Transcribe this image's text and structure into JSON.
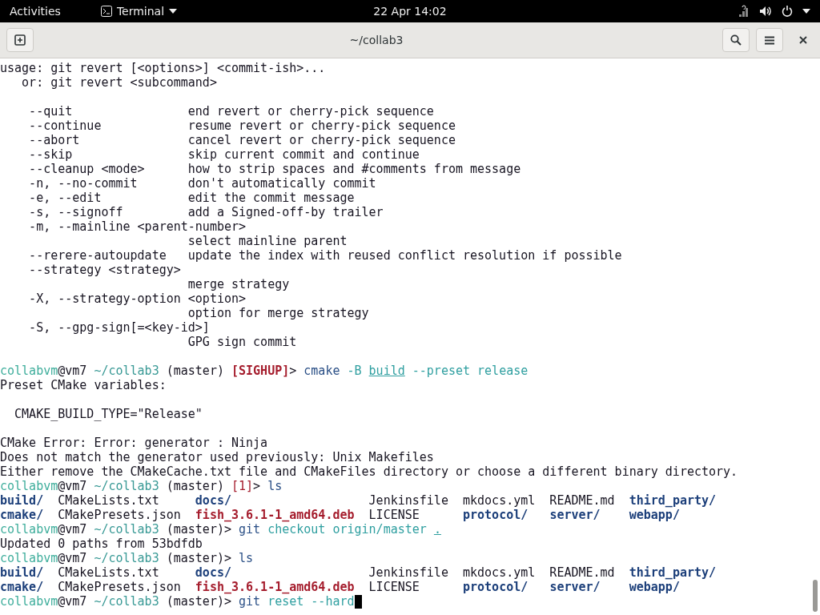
{
  "top_bar": {
    "activities": "Activities",
    "app_menu": "Terminal",
    "clock": "22 Apr  14:02"
  },
  "window": {
    "title": "~/collab3"
  },
  "terminal": {
    "lines": [
      {
        "kind": "text",
        "segments": [
          {
            "text": "usage: git revert [<options>] <commit-ish>...",
            "kind": "plain"
          }
        ]
      },
      {
        "kind": "text",
        "segments": [
          {
            "text": "   or: git revert <subcommand>",
            "kind": "plain"
          }
        ]
      },
      {
        "kind": "gap"
      },
      {
        "kind": "text",
        "segments": [
          {
            "text": "    --quit                end revert or cherry-pick sequence",
            "kind": "plain"
          }
        ]
      },
      {
        "kind": "text",
        "segments": [
          {
            "text": "    --continue            resume revert or cherry-pick sequence",
            "kind": "plain"
          }
        ]
      },
      {
        "kind": "text",
        "segments": [
          {
            "text": "    --abort               cancel revert or cherry-pick sequence",
            "kind": "plain"
          }
        ]
      },
      {
        "kind": "text",
        "segments": [
          {
            "text": "    --skip                skip current commit and continue",
            "kind": "plain"
          }
        ]
      },
      {
        "kind": "text",
        "segments": [
          {
            "text": "    --cleanup <mode>      how to strip spaces and #comments from message",
            "kind": "plain"
          }
        ]
      },
      {
        "kind": "text",
        "segments": [
          {
            "text": "    -n, --no-commit       don't automatically commit",
            "kind": "plain"
          }
        ]
      },
      {
        "kind": "text",
        "segments": [
          {
            "text": "    -e, --edit            edit the commit message",
            "kind": "plain"
          }
        ]
      },
      {
        "kind": "text",
        "segments": [
          {
            "text": "    -s, --signoff         add a Signed-off-by trailer",
            "kind": "plain"
          }
        ]
      },
      {
        "kind": "text",
        "segments": [
          {
            "text": "    -m, --mainline <parent-number>",
            "kind": "plain"
          }
        ]
      },
      {
        "kind": "text",
        "segments": [
          {
            "text": "                          select mainline parent",
            "kind": "plain"
          }
        ]
      },
      {
        "kind": "text",
        "segments": [
          {
            "text": "    --rerere-autoupdate   update the index with reused conflict resolution if possible",
            "kind": "plain"
          }
        ]
      },
      {
        "kind": "text",
        "segments": [
          {
            "text": "    --strategy <strategy>",
            "kind": "plain"
          }
        ]
      },
      {
        "kind": "text",
        "segments": [
          {
            "text": "                          merge strategy",
            "kind": "plain"
          }
        ]
      },
      {
        "kind": "text",
        "segments": [
          {
            "text": "    -X, --strategy-option <option>",
            "kind": "plain"
          }
        ]
      },
      {
        "kind": "text",
        "segments": [
          {
            "text": "                          option for merge strategy",
            "kind": "plain"
          }
        ]
      },
      {
        "kind": "text",
        "segments": [
          {
            "text": "    -S, --gpg-sign[=<key-id>]",
            "kind": "plain"
          }
        ]
      },
      {
        "kind": "text",
        "segments": [
          {
            "text": "                          GPG sign commit",
            "kind": "plain"
          }
        ]
      },
      {
        "kind": "gap"
      },
      {
        "kind": "text",
        "segments": [
          {
            "text": "collabvm",
            "kind": "user"
          },
          {
            "text": "@vm7 ",
            "kind": "plain"
          },
          {
            "text": "~/collab3",
            "kind": "path"
          },
          {
            "text": " (master) ",
            "kind": "plain"
          },
          {
            "text": "[SIGHUP]",
            "kind": "signal"
          },
          {
            "text": "> ",
            "kind": "plain"
          },
          {
            "text": "cmake",
            "kind": "command"
          },
          {
            "text": " -B ",
            "kind": "argument"
          },
          {
            "text": "build",
            "kind": "file"
          },
          {
            "text": " --preset release",
            "kind": "argument"
          }
        ]
      },
      {
        "kind": "text",
        "segments": [
          {
            "text": "Preset CMake variables:",
            "kind": "plain"
          }
        ]
      },
      {
        "kind": "gap"
      },
      {
        "kind": "text",
        "segments": [
          {
            "text": "  CMAKE_BUILD_TYPE=\"Release\"",
            "kind": "plain"
          }
        ]
      },
      {
        "kind": "gap"
      },
      {
        "kind": "text",
        "segments": [
          {
            "text": "CMake Error: Error: generator : Ninja",
            "kind": "plain"
          }
        ]
      },
      {
        "kind": "text",
        "segments": [
          {
            "text": "Does not match the generator used previously: Unix Makefiles",
            "kind": "plain"
          }
        ]
      },
      {
        "kind": "text",
        "segments": [
          {
            "text": "Either remove the CMakeCache.txt file and CMakeFiles directory or choose a different binary directory.",
            "kind": "plain"
          }
        ]
      },
      {
        "kind": "text",
        "segments": [
          {
            "text": "collabvm",
            "kind": "user"
          },
          {
            "text": "@vm7 ",
            "kind": "plain"
          },
          {
            "text": "~/collab3",
            "kind": "path"
          },
          {
            "text": " (master) ",
            "kind": "plain"
          },
          {
            "text": "[1]",
            "kind": "status"
          },
          {
            "text": "> ",
            "kind": "plain"
          },
          {
            "text": "ls",
            "kind": "command"
          }
        ]
      },
      {
        "kind": "text",
        "segments": [
          {
            "text": "build/",
            "kind": "directory"
          },
          {
            "text": "  CMakeLists.txt     ",
            "kind": "plain"
          },
          {
            "text": "docs/",
            "kind": "directory"
          },
          {
            "text": "                   Jenkinsfile  mkdocs.yml  README.md  ",
            "kind": "plain"
          },
          {
            "text": "third_party/",
            "kind": "directory"
          }
        ]
      },
      {
        "kind": "text",
        "segments": [
          {
            "text": "cmake/",
            "kind": "directory"
          },
          {
            "text": "  CMakePresets.json  ",
            "kind": "plain"
          },
          {
            "text": "fish_3.6.1-1_amd64.deb",
            "kind": "package"
          },
          {
            "text": "  LICENSE      ",
            "kind": "plain"
          },
          {
            "text": "protocol/   ",
            "kind": "directory"
          },
          {
            "text": "server/    ",
            "kind": "directory"
          },
          {
            "text": "webapp/",
            "kind": "directory"
          }
        ]
      },
      {
        "kind": "text",
        "segments": [
          {
            "text": "collabvm",
            "kind": "user"
          },
          {
            "text": "@vm7 ",
            "kind": "plain"
          },
          {
            "text": "~/collab3",
            "kind": "path"
          },
          {
            "text": " (master)> ",
            "kind": "plain"
          },
          {
            "text": "git",
            "kind": "command"
          },
          {
            "text": " checkout origin/master ",
            "kind": "argument"
          },
          {
            "text": ".",
            "kind": "file"
          }
        ]
      },
      {
        "kind": "text",
        "segments": [
          {
            "text": "Updated 0 paths from 53bdfdb",
            "kind": "plain"
          }
        ]
      },
      {
        "kind": "text",
        "segments": [
          {
            "text": "collabvm",
            "kind": "user"
          },
          {
            "text": "@vm7 ",
            "kind": "plain"
          },
          {
            "text": "~/collab3",
            "kind": "path"
          },
          {
            "text": " (master)> ",
            "kind": "plain"
          },
          {
            "text": "ls",
            "kind": "command"
          }
        ]
      },
      {
        "kind": "text",
        "segments": [
          {
            "text": "build/",
            "kind": "directory"
          },
          {
            "text": "  CMakeLists.txt     ",
            "kind": "plain"
          },
          {
            "text": "docs/",
            "kind": "directory"
          },
          {
            "text": "                   Jenkinsfile  mkdocs.yml  README.md  ",
            "kind": "plain"
          },
          {
            "text": "third_party/",
            "kind": "directory"
          }
        ]
      },
      {
        "kind": "text",
        "segments": [
          {
            "text": "cmake/",
            "kind": "directory"
          },
          {
            "text": "  CMakePresets.json  ",
            "kind": "plain"
          },
          {
            "text": "fish_3.6.1-1_amd64.deb",
            "kind": "package"
          },
          {
            "text": "  LICENSE      ",
            "kind": "plain"
          },
          {
            "text": "protocol/   ",
            "kind": "directory"
          },
          {
            "text": "server/    ",
            "kind": "directory"
          },
          {
            "text": "webapp/",
            "kind": "directory"
          }
        ]
      },
      {
        "kind": "prompt",
        "segments": [
          {
            "text": "collabvm",
            "kind": "user"
          },
          {
            "text": "@vm7 ",
            "kind": "plain"
          },
          {
            "text": "~/collab3",
            "kind": "path"
          },
          {
            "text": " (master)> ",
            "kind": "plain"
          },
          {
            "text": "git",
            "kind": "command"
          },
          {
            "text": " reset --hard",
            "kind": "argument"
          }
        ]
      }
    ]
  }
}
